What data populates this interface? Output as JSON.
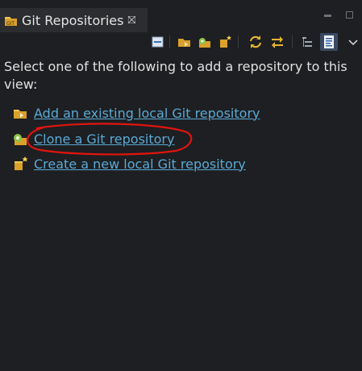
{
  "view": {
    "title": "Git Repositories",
    "close_symbol": "⛝"
  },
  "toolbar": {
    "icons": [
      "collapse-all-icon",
      "add-repository-icon",
      "clone-repository-icon",
      "create-repository-icon",
      "refresh-icon",
      "link-with-selection-icon",
      "hierarchical-view-icon",
      "repository-view-mode-icon",
      "view-menu-chevron-icon"
    ]
  },
  "content": {
    "intro": "Select one of the following to add a repository to this view:",
    "actions": [
      {
        "label": "Add an existing local Git repository",
        "icon": "add-repository-icon"
      },
      {
        "label": "Clone a Git repository",
        "icon": "clone-repository-icon"
      },
      {
        "label": "Create a new local Git repository",
        "icon": "create-repository-icon"
      }
    ]
  },
  "colors": {
    "background": "#1e1f22",
    "link": "#5aaad6",
    "annotation": "#e0140f"
  }
}
